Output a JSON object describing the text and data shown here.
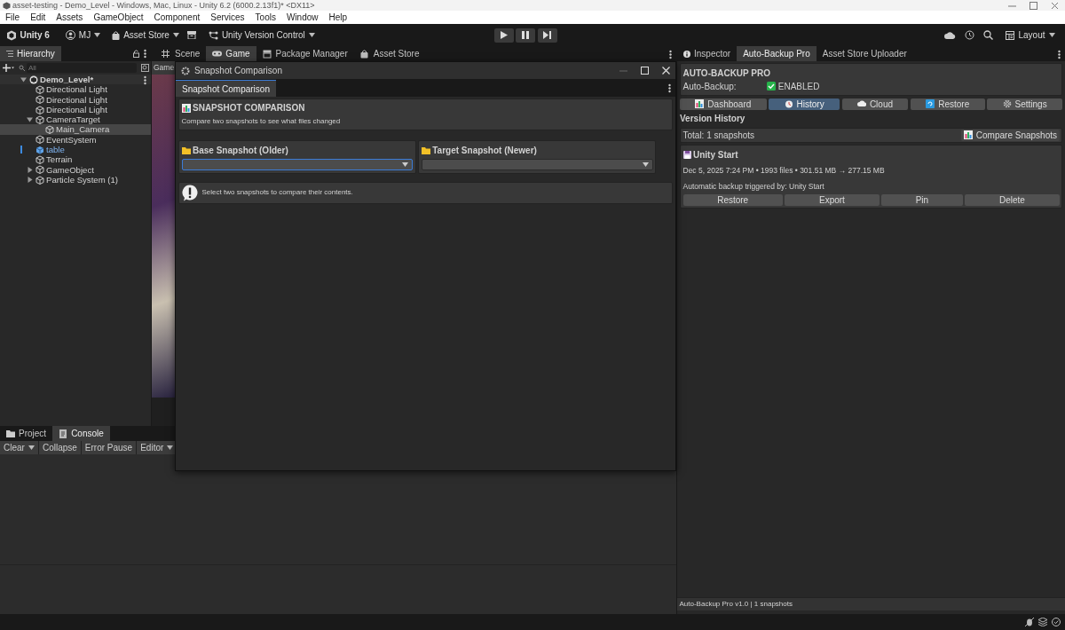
{
  "window": {
    "title": "asset-testing - Demo_Level - Windows, Mac, Linux - Unity 6.2 (6000.2.13f1)* <DX11>"
  },
  "menu": [
    "File",
    "Edit",
    "Assets",
    "GameObject",
    "Component",
    "Services",
    "Tools",
    "Window",
    "Help"
  ],
  "toolbar": {
    "product": "Unity 6",
    "account": "MJ",
    "asset_store": "Asset Store",
    "version_control": "Unity Version Control",
    "layout": "Layout"
  },
  "hierarchy": {
    "title": "Hierarchy",
    "search_placeholder": "All",
    "scene": {
      "label": "Demo_Level*",
      "expanded": true,
      "children": [
        {
          "label": "Directional Light",
          "kind": "object",
          "selected": false
        },
        {
          "label": "Directional Light",
          "kind": "object",
          "selected": false
        },
        {
          "label": "Directional Light",
          "kind": "object",
          "selected": false
        },
        {
          "label": "CameraTarget",
          "kind": "object",
          "selected": false,
          "expanded": true,
          "children": [
            {
              "label": "Main_Camera",
              "kind": "object",
              "selected": true
            }
          ]
        },
        {
          "label": "EventSystem",
          "kind": "object",
          "selected": false
        },
        {
          "label": "table",
          "kind": "prefab",
          "selected": false
        },
        {
          "label": "Terrain",
          "kind": "object",
          "selected": false
        },
        {
          "label": "GameObject",
          "kind": "object",
          "selected": false,
          "expanded": false
        },
        {
          "label": "Particle System (1)",
          "kind": "object",
          "selected": false,
          "expanded": false
        }
      ]
    }
  },
  "view_tabs": [
    {
      "label": "Scene",
      "kind": "scene",
      "selected": false
    },
    {
      "label": "Game",
      "kind": "game",
      "selected": true
    },
    {
      "label": "Package Manager",
      "kind": "package",
      "selected": false
    },
    {
      "label": "Asset Store",
      "kind": "store",
      "selected": false
    }
  ],
  "game_view": {
    "label": "Game"
  },
  "bottom_tabs": [
    {
      "label": "Project",
      "kind": "folder",
      "selected": false
    },
    {
      "label": "Console",
      "kind": "console",
      "selected": true
    }
  ],
  "console_toolbar": [
    {
      "label": "Clear",
      "kind": "dropdown"
    },
    {
      "label": "Collapse",
      "kind": "button"
    },
    {
      "label": "Error Pause",
      "kind": "button"
    },
    {
      "label": "Editor",
      "kind": "dropdown"
    }
  ],
  "inspector_tabs": [
    {
      "label": "Inspector",
      "kind": "info",
      "selected": false
    },
    {
      "label": "Auto-Backup Pro",
      "kind": "plain",
      "selected": true
    },
    {
      "label": "Asset Store Uploader",
      "kind": "plain",
      "selected": false
    }
  ],
  "auto_backup": {
    "title": "AUTO-BACKUP PRO",
    "toggle_label": "Auto-Backup:",
    "enabled": true,
    "enabled_label": "ENABLED",
    "tabs": [
      {
        "label": "Dashboard",
        "kind": "chart",
        "selected": false
      },
      {
        "label": "History",
        "kind": "clock",
        "selected": true
      },
      {
        "label": "Cloud",
        "kind": "cloud",
        "selected": false
      },
      {
        "label": "Restore",
        "kind": "restore",
        "selected": false
      },
      {
        "label": "Settings",
        "kind": "gear",
        "selected": false
      }
    ],
    "section_title": "Version History",
    "total": "Total: 1 snapshots",
    "compare_button": "Compare Snapshots",
    "snapshots": [
      {
        "name": "Unity Start",
        "meta": "Dec 5, 2025 7:24 PM • 1993 files • 301.51 MB → 277.15 MB",
        "note": "Automatic backup triggered by: Unity Start",
        "actions": [
          "Restore",
          "Export",
          "Pin",
          "Delete"
        ]
      }
    ],
    "footer": "Auto-Backup Pro v1.0 | 1 snapshots"
  },
  "snapshot_window": {
    "title": "Snapshot Comparison",
    "tab": "Snapshot Comparison",
    "heading": "SNAPSHOT COMPARISON",
    "subtitle": "Compare two snapshots to see what files changed",
    "selectors": [
      {
        "label": "Base Snapshot (Older)",
        "focused": true
      },
      {
        "label": "Target Snapshot (Newer)",
        "focused": false
      }
    ],
    "message": "Select two snapshots to compare their contents."
  }
}
